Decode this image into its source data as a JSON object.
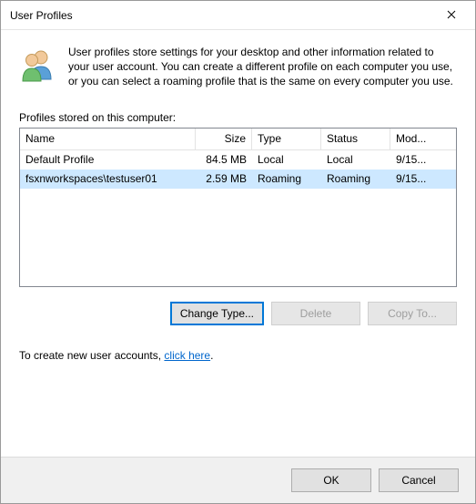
{
  "window": {
    "title": "User Profiles"
  },
  "description": "User profiles store settings for your desktop and other information related to your user account. You can create a different profile on each computer you use, or you can select a roaming profile that is the same on every computer you use.",
  "section_label": "Profiles stored on this computer:",
  "columns": {
    "name": "Name",
    "size": "Size",
    "type": "Type",
    "status": "Status",
    "modified": "Mod..."
  },
  "rows": [
    {
      "name": "Default Profile",
      "size": "84.5 MB",
      "type": "Local",
      "status": "Local",
      "modified": "9/15..."
    },
    {
      "name": "fsxnworkspaces\\testuser01",
      "size": "2.59 MB",
      "type": "Roaming",
      "status": "Roaming",
      "modified": "9/15..."
    }
  ],
  "buttons": {
    "change_type": "Change Type...",
    "delete": "Delete",
    "copy_to": "Copy To...",
    "ok": "OK",
    "cancel": "Cancel"
  },
  "hint_prefix": "To create new user accounts, ",
  "hint_link": "click here",
  "hint_suffix": "."
}
